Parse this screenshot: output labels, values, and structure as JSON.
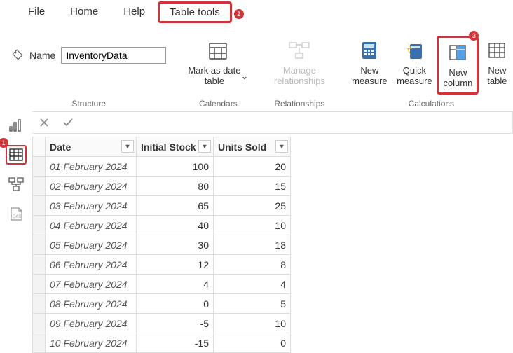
{
  "menu": {
    "file": "File",
    "home": "Home",
    "help": "Help",
    "table_tools": "Table tools"
  },
  "badges": {
    "one": "1",
    "two": "2",
    "three": "3"
  },
  "name_field": {
    "label": "Name",
    "value": "InventoryData"
  },
  "ribbon": {
    "structure_label": "Structure",
    "calendars_label": "Calendars",
    "relationships_label": "Relationships",
    "calculations_label": "Calculations",
    "mark_as_date": "Mark as date\ntable",
    "mark_dropdown": "⌄",
    "manage_rel": "Manage\nrelationships",
    "new_measure": "New\nmeasure",
    "quick_measure": "Quick\nmeasure",
    "new_column": "New\ncolumn",
    "new_table": "New\ntable"
  },
  "table": {
    "headers": {
      "date": "Date",
      "initial": "Initial Stock",
      "sold": "Units Sold"
    },
    "rows": [
      {
        "date": "01 February 2024",
        "initial": "100",
        "sold": "20"
      },
      {
        "date": "02 February 2024",
        "initial": "80",
        "sold": "15"
      },
      {
        "date": "03 February 2024",
        "initial": "65",
        "sold": "25"
      },
      {
        "date": "04 February 2024",
        "initial": "40",
        "sold": "10"
      },
      {
        "date": "05 February 2024",
        "initial": "30",
        "sold": "18"
      },
      {
        "date": "06 February 2024",
        "initial": "12",
        "sold": "8"
      },
      {
        "date": "07 February 2024",
        "initial": "4",
        "sold": "4"
      },
      {
        "date": "08 February 2024",
        "initial": "0",
        "sold": "5"
      },
      {
        "date": "09 February 2024",
        "initial": "-5",
        "sold": "10"
      },
      {
        "date": "10 February 2024",
        "initial": "-15",
        "sold": "0"
      }
    ]
  }
}
